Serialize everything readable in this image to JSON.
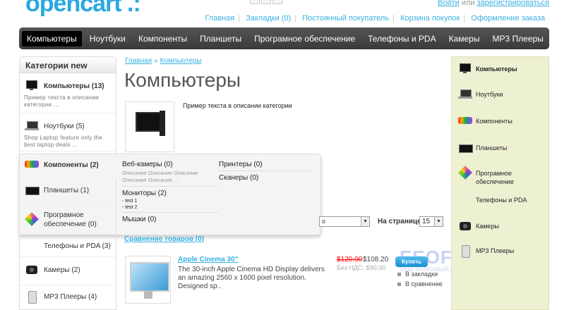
{
  "header": {
    "logo": "opencart .:",
    "account_login": "Войти",
    "account_or": "или",
    "account_register": "зарегистрироваться",
    "links": [
      "Главная",
      "Закладки (0)",
      "Постоянный покупатель",
      "Корзина покупок",
      "Оформление заказа"
    ]
  },
  "menu": [
    "Компьютеры",
    "Ноутбуки",
    "Компоненты",
    "Планшеты",
    "Програмное обеспечение",
    "Телефоны и PDA",
    "Камеры",
    "MP3 Плееры"
  ],
  "left": {
    "title": "Категории new",
    "items": [
      {
        "label": "Компьютеры (13)",
        "desc": "Пример текста в описании категории ..."
      },
      {
        "label": "Ноутбуки (5)",
        "desc": "Shop Laptop feature only the best laptop deals ..."
      },
      {
        "label": "Компоненты (2)"
      },
      {
        "label": "Планшеты (1)"
      },
      {
        "label": "Програмное обеспечение (0)"
      },
      {
        "label": "Телефоны и PDA (3)"
      },
      {
        "label": "Камеры (2)"
      },
      {
        "label": "MP3 Плееры (4)"
      }
    ]
  },
  "breadcrumb": {
    "home": "Главная",
    "sep": "»",
    "current": "Компьютеры"
  },
  "page_title": "Компьютеры",
  "category_desc": "Пример текста в описании категории",
  "flyout": {
    "webcams": "Веб-камеры (0)",
    "webcams_desc": "Описание Описание Описание Описание Описание ...",
    "monitors": "Мониторы (2)",
    "sub1": "- test 1",
    "sub2": "- test 2",
    "mice": "Мышки (0)",
    "printers": "Принтеры (0)",
    "scanners": "Сканеры (0)"
  },
  "controls": {
    "sort_value": "o",
    "perpage_label": "На странице:",
    "perpage_value": "15"
  },
  "compare": "Сравнение товаров (0)",
  "product": {
    "name": "Apple Cinema 30\"",
    "desc": "The 30-inch Apple Cinema HD Display delivers an amazing 2560 x 1600 pixel resolution. Designed sp..",
    "old_price": "$120.00",
    "new_price": "$108.20",
    "tax": "Без НДС: $90.00",
    "buy": "Купить",
    "wishlist": "В закладки",
    "compare": "В сравнение"
  },
  "watermark": {
    "title": "EEOFAN.NET",
    "subtitle": "НАШ ЗНАКОМЫЙ ДРУГ ДИЗАЙНЕРА"
  },
  "right": [
    "Компьютеры",
    "Ноутбуки",
    "Компоненты",
    "Планшеты",
    "Програмное обеспечение",
    "Телефоны и PDA",
    "Камеры",
    "MP3 Плееры"
  ]
}
